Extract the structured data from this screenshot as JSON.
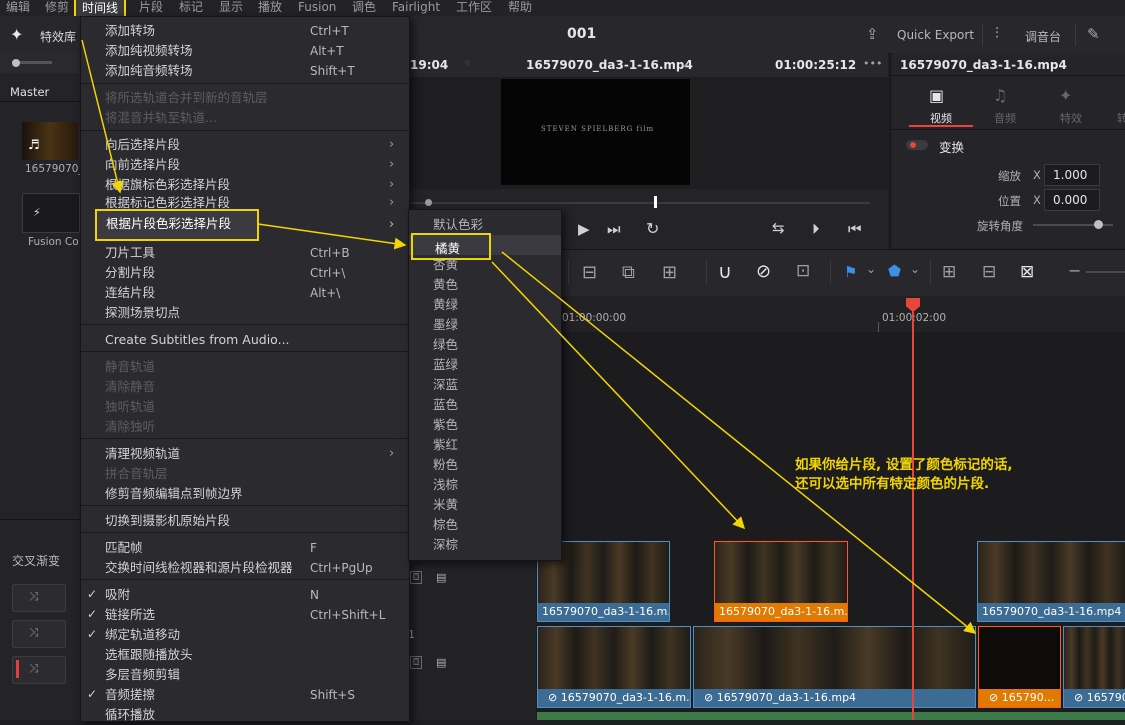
{
  "menubar": {
    "items": [
      "编辑",
      "修剪",
      "时间线",
      "片段",
      "标记",
      "显示",
      "播放",
      "Fusion",
      "调色",
      "Fairlight",
      "工作区",
      "帮助"
    ]
  },
  "topbar": {
    "effects_library": "特效库",
    "project_title": "001",
    "quick_export": "Quick Export",
    "mixer": "调音台"
  },
  "left_panel": {
    "master_label": "Master",
    "media_clip_name": "16579070_",
    "fusion_label": "Fusion Co",
    "transitions_label": "交叉渐变"
  },
  "viewer": {
    "timecode_left": "19:04",
    "clip_name": "16579070_da3-1-16.mp4",
    "timecode_right": "01:00:25:12",
    "more": "•••",
    "image_caption": "STEVEN SPIELBERG film"
  },
  "inspector": {
    "clip_name": "16579070_da3-1-16.mp4",
    "tabs": [
      "视频",
      "音频",
      "特效",
      "转"
    ],
    "transform_label": "变换",
    "zoom_label": "缩放",
    "zoom_axis": "X",
    "zoom_value": "1.000",
    "position_label": "位置",
    "position_axis": "X",
    "position_value": "0.000",
    "rotation_label": "旋转角度"
  },
  "timeline": {
    "ruler_tc1": "01:00:00:00",
    "ruler_tc2": "01:00:02:00",
    "video_clips_v2": [
      {
        "name": "16579070_da3-1-16.m...",
        "color": "blue"
      },
      {
        "name": "16579070_da3-1-16.m...",
        "color": "orange"
      },
      {
        "name": "16579070_da3-1-16.mp4",
        "color": "blue"
      }
    ],
    "video_clips_v1": [
      {
        "name": "16579070_da3-1-16.m...",
        "color": "blue"
      },
      {
        "name": "16579070_da3-1-16.mp4",
        "color": "blue"
      },
      {
        "name": "165790...",
        "color": "orange"
      },
      {
        "name": "165790",
        "color": "blue"
      }
    ],
    "track_num": "1"
  },
  "main_menu": {
    "title": "时间线",
    "items": [
      {
        "label": "添加转场",
        "shortcut": "Ctrl+T",
        "enabled": true
      },
      {
        "label": "添加纯视频转场",
        "shortcut": "Alt+T",
        "enabled": true
      },
      {
        "label": "添加纯音频转场",
        "shortcut": "Shift+T",
        "enabled": true
      },
      {
        "label": "将所选轨道合并到新的音轨层",
        "shortcut": "",
        "enabled": false
      },
      {
        "label": "将混音并轨至轨道...",
        "shortcut": "",
        "enabled": false
      },
      {
        "label": "向后选择片段",
        "shortcut": "",
        "enabled": true,
        "submenu": true
      },
      {
        "label": "向前选择片段",
        "shortcut": "",
        "enabled": true,
        "submenu": true
      },
      {
        "label": "根据旗标色彩选择片段",
        "shortcut": "",
        "enabled": true,
        "submenu": true
      },
      {
        "label": "根据标记色彩选择片段",
        "shortcut": "",
        "enabled": true,
        "submenu": true
      },
      {
        "label": "根据片段色彩选择片段",
        "shortcut": "",
        "enabled": true,
        "submenu": true
      },
      {
        "label": "刀片工具",
        "shortcut": "Ctrl+B",
        "enabled": true
      },
      {
        "label": "分割片段",
        "shortcut": "Ctrl+\\",
        "enabled": true
      },
      {
        "label": "连结片段",
        "shortcut": "Alt+\\",
        "enabled": true
      },
      {
        "label": "探测场景切点",
        "shortcut": "",
        "enabled": true
      },
      {
        "label": "Create Subtitles from Audio...",
        "shortcut": "",
        "enabled": true
      },
      {
        "label": "静音轨道",
        "shortcut": "",
        "enabled": false
      },
      {
        "label": "清除静音",
        "shortcut": "",
        "enabled": false
      },
      {
        "label": "独听轨道",
        "shortcut": "",
        "enabled": false
      },
      {
        "label": "清除独听",
        "shortcut": "",
        "enabled": false
      },
      {
        "label": "清理视频轨道",
        "shortcut": "",
        "enabled": true,
        "submenu": true
      },
      {
        "label": "拼合音轨层",
        "shortcut": "",
        "enabled": false
      },
      {
        "label": "修剪音频编辑点到帧边界",
        "shortcut": "",
        "enabled": true
      },
      {
        "label": "切换到摄影机原始片段",
        "shortcut": "",
        "enabled": true
      },
      {
        "label": "匹配帧",
        "shortcut": "F",
        "enabled": true
      },
      {
        "label": "交换时间线检视器和源片段检视器",
        "shortcut": "Ctrl+PgUp",
        "enabled": true
      },
      {
        "label": "吸附",
        "shortcut": "N",
        "enabled": true,
        "checked": true
      },
      {
        "label": "链接所选",
        "shortcut": "Ctrl+Shift+L",
        "enabled": true,
        "checked": true
      },
      {
        "label": "绑定轨道移动",
        "shortcut": "",
        "enabled": true,
        "checked": true
      },
      {
        "label": "选框跟随播放头",
        "shortcut": "",
        "enabled": true
      },
      {
        "label": "多层音频剪辑",
        "shortcut": "",
        "enabled": true
      },
      {
        "label": "音频搓擦",
        "shortcut": "Shift+S",
        "enabled": true,
        "checked": true
      },
      {
        "label": "循环播放",
        "shortcut": "",
        "enabled": true
      }
    ]
  },
  "color_submenu": {
    "items": [
      "默认色彩",
      "橘黄",
      "杏黄",
      "黄色",
      "黄绿",
      "墨绿",
      "绿色",
      "蓝绿",
      "深蓝",
      "蓝色",
      "紫色",
      "紫红",
      "粉色",
      "浅棕",
      "米黄",
      "棕色",
      "深棕"
    ],
    "highlighted": "橘黄"
  },
  "annotation": {
    "line1": "如果你给片段, 设置了颜色标记的话,",
    "line2": "还可以选中所有特定颜色的片段."
  },
  "colors": {
    "highlight": "#f2d500",
    "clip_blue": "#3c6b93",
    "clip_orange": "#e07a00",
    "playhead": "#e8463a"
  }
}
